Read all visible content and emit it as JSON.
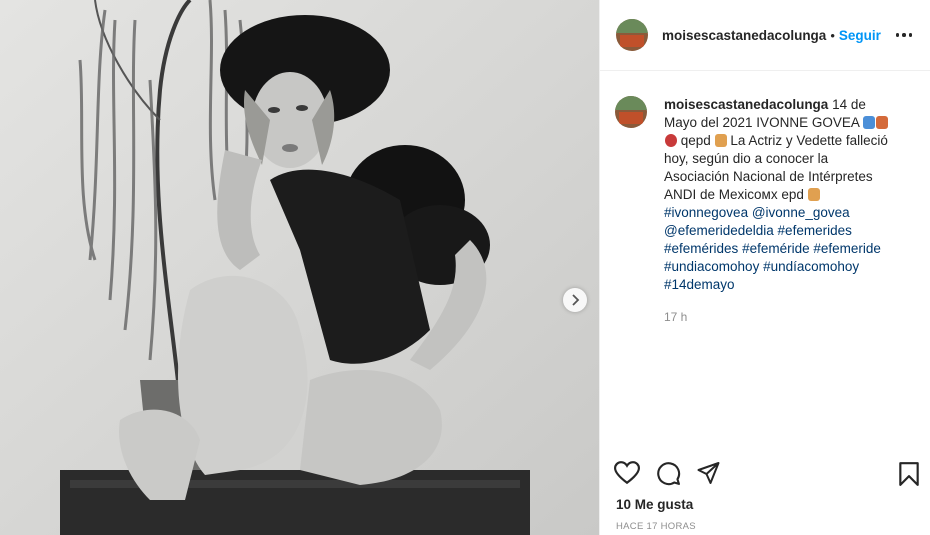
{
  "post": {
    "image_alt": "Fotografía en blanco y negro de una mujer con sombrero de piel",
    "next_icon": "chevron-right-icon"
  },
  "header": {
    "username": "moisescastanedacolunga",
    "separator": "•",
    "follow_label": "Seguir",
    "more_icon": "more-horizontal-icon"
  },
  "caption": {
    "username": "moisescastanedacolunga",
    "text_1": "14 de Mayo del 2021 IVONNE GOVEA",
    "text_2": "qepd",
    "text_3": "La Actriz y Vedette falleció hoy, según dio a conocer la Asociación Nacional de Intérpretes ANDI de Mexicoмх epd",
    "hashtags": [
      "#ivonnegovea",
      "@ivonne_govea",
      "@efemeridedeldia",
      "#efemerides",
      "#efemérides",
      "#efeméride",
      "#efemeride",
      "#undiacomohoy",
      "#undíacomohoy",
      "#14demayo"
    ],
    "time": "17 h"
  },
  "actions": {
    "like_icon": "heart-icon",
    "comment_icon": "comment-icon",
    "share_icon": "send-icon",
    "save_icon": "bookmark-icon"
  },
  "likes": "10 Me gusta",
  "posted_ago": "HACE 17 HORAS",
  "colors": {
    "follow": "#0095f6",
    "hashtag": "#00376b",
    "muted": "#8e8e8e",
    "text": "#262626"
  }
}
